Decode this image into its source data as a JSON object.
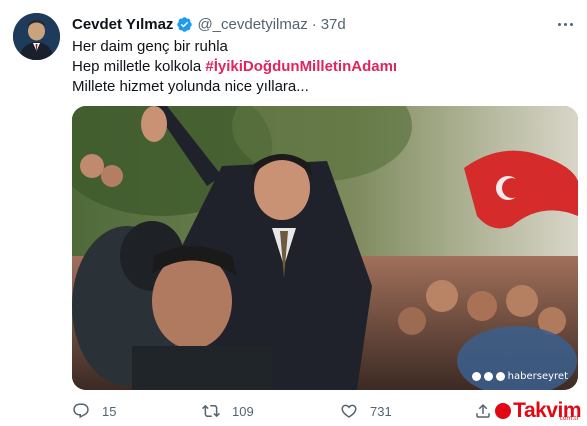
{
  "tweet": {
    "author_name": "Cevdet Yılmaz",
    "handle": "@_cevdetyilmaz",
    "separator": "·",
    "time": "37d",
    "verified": true,
    "lines": [
      {
        "text": "Her daim genç bir ruhla"
      },
      {
        "prefix": "Hep milletle kolkola ",
        "hashtag": "#İyikiDoğdunMilletinAdamı"
      },
      {
        "text": "Millete hizmet yolunda nice yıllara..."
      }
    ],
    "hashtag_color": "#e0245e"
  },
  "media": {
    "watermark": "haberseyret"
  },
  "actions": {
    "reply_count": "15",
    "retweet_count": "109",
    "like_count": "731"
  },
  "brand": {
    "logo_text": "Takvim",
    "domain": "com.tr"
  },
  "icons": {
    "verified": "verified-badge-icon",
    "more": "more-options-icon",
    "reply": "reply-icon",
    "retweet": "retweet-icon",
    "like": "heart-icon",
    "share": "share-icon"
  },
  "colors": {
    "text_primary": "#0f1419",
    "text_secondary": "#536471",
    "verified_blue": "#1d9bf0",
    "brand_red": "#e30613"
  }
}
